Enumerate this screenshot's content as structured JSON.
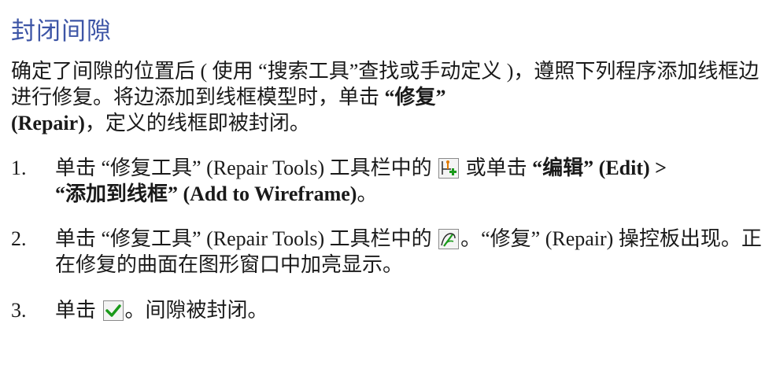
{
  "title": "封闭间隙",
  "intro": {
    "p1": "确定了间隙的位置后 ( 使用 “搜索工具”查找或手动定义 )，遵照下列程序添加线框边进行修复。将边添加到线框模型时，单击 ",
    "repair_bold": "“修复”",
    "repair_en": "(Repair)",
    "p2": "，定义的线框即被封闭。"
  },
  "steps": [
    {
      "num": "1.",
      "a": "单击 “修复工具” (Repair Tools) 工具栏中的 ",
      "b": " 或单击 ",
      "edit_bold": "“编辑” (Edit) >",
      "add_bold": "“添加到线框” (Add to Wireframe)",
      "c": "。"
    },
    {
      "num": "2.",
      "a": "单击 “修复工具” (Repair Tools) 工具栏中的 ",
      "b": "。“修复” (Repair) 操控板出现。正在修复的曲面在图形窗口中加亮显示。"
    },
    {
      "num": "3.",
      "a": "单击 ",
      "b": "。间隙被封闭。"
    }
  ],
  "icons": {
    "add_wireframe": "add-to-wireframe-icon",
    "repair": "repair-icon",
    "ok": "green-checkmark-icon"
  },
  "colors": {
    "title": "#3d55a6",
    "check": "#1a9a1a"
  }
}
